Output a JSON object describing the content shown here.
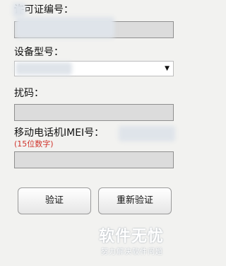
{
  "form": {
    "license_label": "许可证编号：",
    "device_label": "设备型号：",
    "code_label": "扰码：",
    "imei_label": "移动电话机IMEI号：",
    "imei_hint": "(15位数字)",
    "device_dropdown_icon": "triangle-down-icon"
  },
  "buttons": {
    "verify": "验证",
    "reverify": "重新验证"
  },
  "watermark": {
    "logo": "软件无忧",
    "subtitle": "努力解决软件问题"
  }
}
